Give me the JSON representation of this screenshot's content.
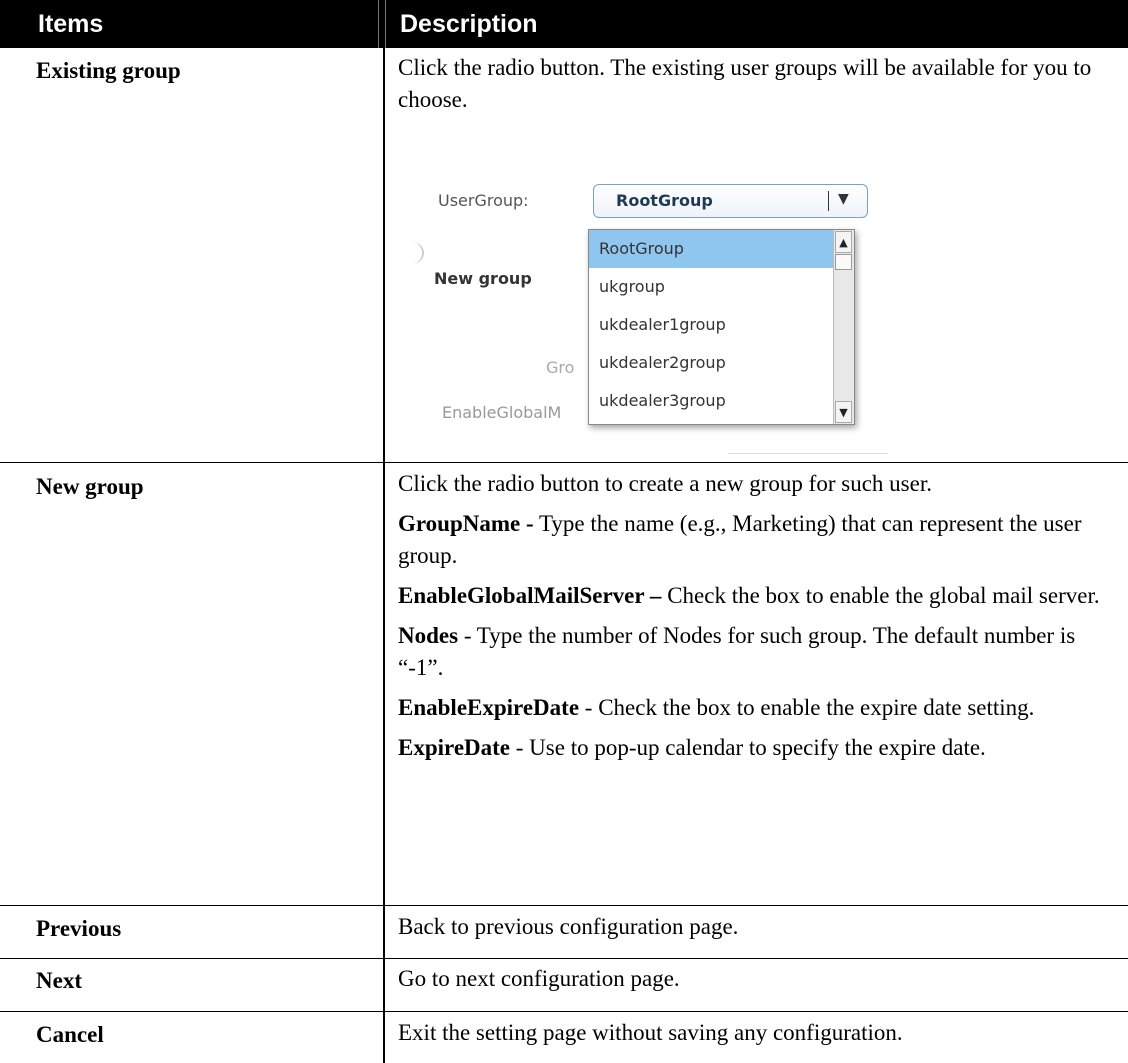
{
  "header": {
    "items": "Items",
    "description": "Description"
  },
  "rows": [
    {
      "item": "Existing group",
      "desc": "Click the radio button. The existing user groups will be available for you to choose."
    },
    {
      "item": "New group",
      "paras": [
        {
          "bold": "",
          "text": "Click the radio button to create a new group for such user."
        },
        {
          "bold": "GroupName -",
          "text": " Type the name (e.g., Marketing) that can represent the user group."
        },
        {
          "bold": "EnableGlobalMailServer –",
          "text": " Check the box to enable the global mail server."
        },
        {
          "bold": "Nodes",
          "text": " - Type the number of Nodes for such group. The default number is “-1”."
        },
        {
          "bold": "EnableExpireDate",
          "text": " - Check the box to enable the expire date setting."
        },
        {
          "bold": "ExpireDate",
          "text": " - Use to pop-up calendar to specify the expire date."
        }
      ]
    },
    {
      "item": "Previous",
      "desc": "Back to previous configuration page."
    },
    {
      "item": "Next",
      "desc": "Go to next configuration page."
    },
    {
      "item": "Cancel",
      "desc": "Exit the setting page without saving any configuration."
    }
  ],
  "screenshot": {
    "usergroup_label": "UserGroup:",
    "selected": "RootGroup",
    "new_group_label": "New group",
    "partial_label_1": "Gro",
    "partial_label_2": "EnableGlobalM",
    "options": [
      "RootGroup",
      "ukgroup",
      "ukdealer1group",
      "ukdealer2group",
      "ukdealer3group"
    ]
  }
}
